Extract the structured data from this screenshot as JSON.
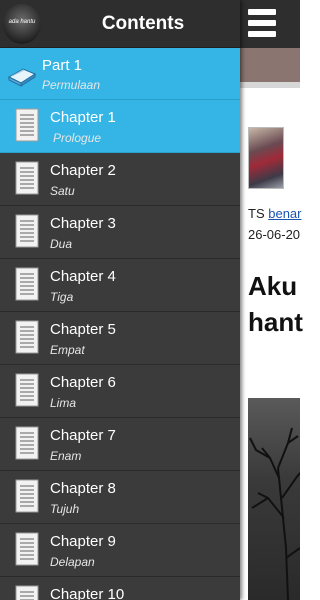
{
  "app": {
    "drawer_title": "Contents",
    "avatar_text": "ada hantu"
  },
  "parts": [
    {
      "label": "Part 1",
      "sublabel": "Permulaan"
    }
  ],
  "chapters": [
    {
      "label": "Chapter 1",
      "sublabel": "Prologue"
    },
    {
      "label": "Chapter 2",
      "sublabel": "Satu"
    },
    {
      "label": "Chapter 3",
      "sublabel": "Dua"
    },
    {
      "label": "Chapter 4",
      "sublabel": "Tiga"
    },
    {
      "label": "Chapter 5",
      "sublabel": "Empat"
    },
    {
      "label": "Chapter 6",
      "sublabel": "Lima"
    },
    {
      "label": "Chapter 7",
      "sublabel": "Enam"
    },
    {
      "label": "Chapter 8",
      "sublabel": "Tujuh"
    },
    {
      "label": "Chapter 9",
      "sublabel": "Delapan"
    },
    {
      "label": "Chapter 10",
      "sublabel": ""
    }
  ],
  "selected_chapter": "Chapter 1",
  "content": {
    "author_prefix": "TS ",
    "author_link": "benar",
    "date": "26-06-20",
    "headline": "Aku\nhant"
  },
  "colors": {
    "accent": "#35b5e5",
    "drawer_bg": "#3b3b3b",
    "header_bg": "#2e2e2e"
  },
  "icons": {
    "menu": "hamburger-icon",
    "part": "book-icon",
    "chapter": "document-icon"
  }
}
